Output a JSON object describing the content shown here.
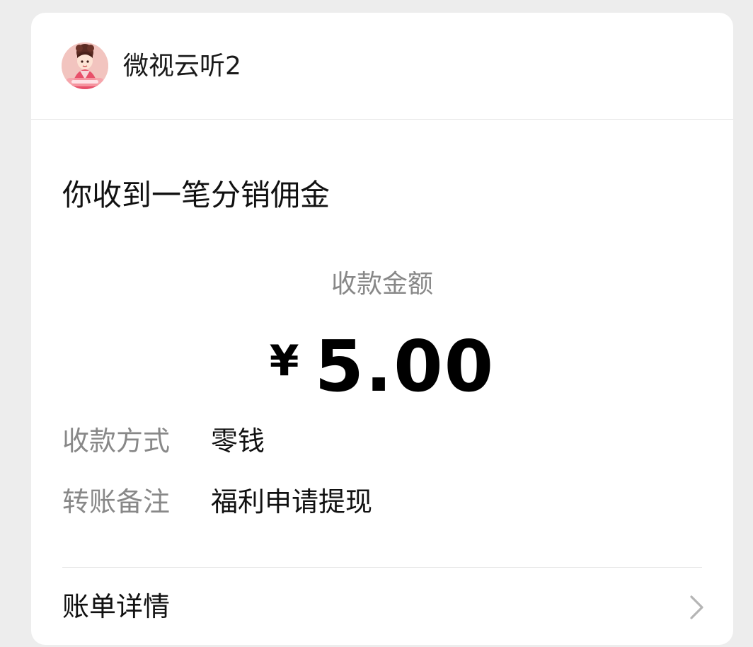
{
  "header": {
    "app_name": "微视云听2",
    "avatar": "app-avatar-illustration"
  },
  "notice": {
    "title": "你收到一笔分销佣金"
  },
  "amount": {
    "label": "收款金额",
    "currency": "¥",
    "value": "5.00"
  },
  "details": [
    {
      "label": "收款方式",
      "value": "零钱"
    },
    {
      "label": "转账备注",
      "value": "福利申请提现"
    }
  ],
  "bill": {
    "label": "账单详情",
    "icon": "chevron-right-icon"
  },
  "colors": {
    "background": "#ededed",
    "card": "#ffffff",
    "muted_text": "#888888",
    "primary_text": "#111111",
    "divider": "#e6e6e6"
  }
}
